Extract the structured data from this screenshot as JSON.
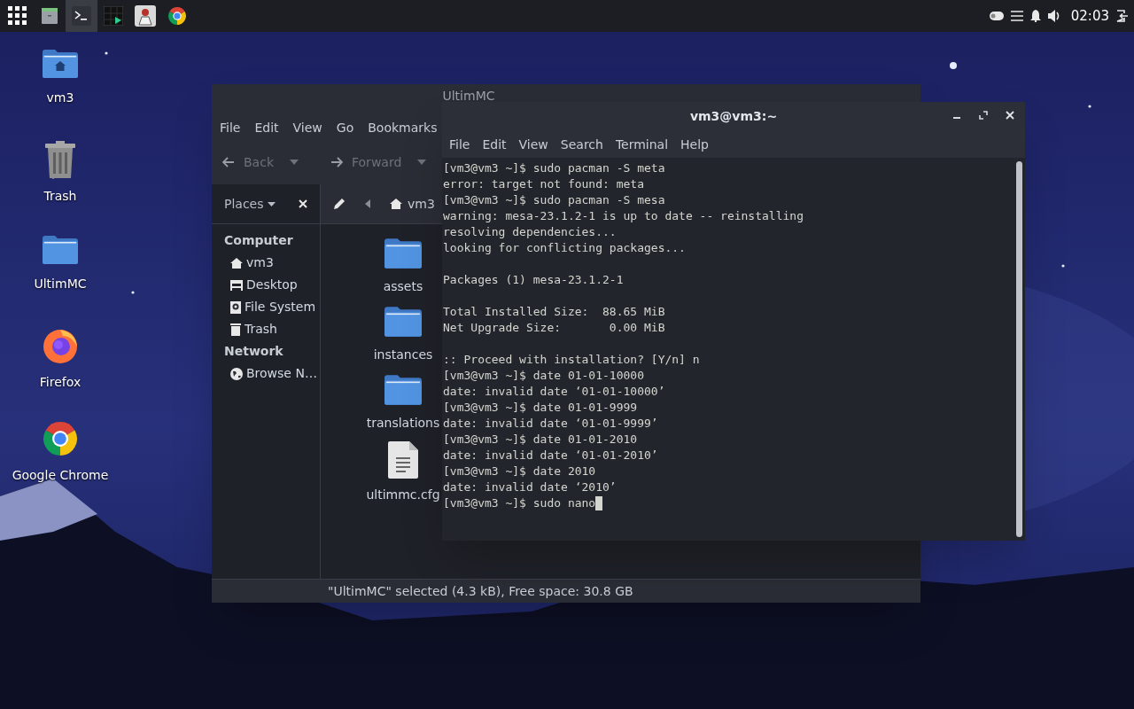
{
  "top_bar": {
    "launchers": [
      {
        "kind": "grid",
        "selected": false
      },
      {
        "kind": "files",
        "selected": false
      },
      {
        "kind": "terminal",
        "selected": true
      },
      {
        "kind": "monitor",
        "selected": false
      },
      {
        "kind": "game",
        "selected": false
      },
      {
        "kind": "browser",
        "selected": false
      }
    ],
    "clock": "02:03"
  },
  "desktop_icons": [
    {
      "label": "vm3",
      "kind": "home"
    },
    {
      "label": "Trash",
      "kind": "trash"
    },
    {
      "label": "UltimMC",
      "kind": "folder"
    },
    {
      "label": "Firefox",
      "kind": "firefox"
    },
    {
      "label": "Google Chrome",
      "kind": "chrome"
    }
  ],
  "file_manager": {
    "title": "UltimMC",
    "menu": [
      "File",
      "Edit",
      "View",
      "Go",
      "Bookmarks"
    ],
    "toolbar": [
      {
        "label": "Back",
        "kind": "back",
        "disabled": true
      },
      {
        "label": "Forward",
        "kind": "forward",
        "disabled": true
      }
    ],
    "places_label": "Places",
    "path": "vm3",
    "sidebar": [
      {
        "heading": "Computer",
        "items": [
          {
            "label": "vm3",
            "kind": "home"
          },
          {
            "label": "Desktop",
            "kind": "desktop"
          },
          {
            "label": "File System",
            "kind": "drive"
          },
          {
            "label": "Trash",
            "kind": "trash"
          }
        ]
      },
      {
        "heading": "Network",
        "items": [
          {
            "label": "Browse N…",
            "kind": "network"
          }
        ]
      }
    ],
    "files": [
      {
        "name": "assets",
        "kind": "folder"
      },
      {
        "name": "instances",
        "kind": "folder"
      },
      {
        "name": "translations",
        "kind": "folder"
      },
      {
        "name": "ultimmc.cfg",
        "kind": "document"
      }
    ],
    "status": "\"UltimMC\" selected (4.3 kB), Free space: 30.8 GB"
  },
  "terminal": {
    "title": "vm3@vm3:~",
    "menu": [
      "File",
      "Edit",
      "View",
      "Search",
      "Terminal",
      "Help"
    ],
    "blocks": [
      [
        "[vm3@vm3 ~]$ sudo pacman -S meta",
        "error: target not found: meta",
        "[vm3@vm3 ~]$ sudo pacman -S mesa",
        "warning: mesa-23.1.2-1 is up to date -- reinstalling",
        "resolving dependencies...",
        "looking for conflicting packages..."
      ],
      [
        "Packages (1) mesa-23.1.2-1"
      ],
      [
        "Total Installed Size:  88.65 MiB",
        "Net Upgrade Size:       0.00 MiB"
      ],
      [
        ":: Proceed with installation? [Y/n] n",
        "[vm3@vm3 ~]$ date 01-01-10000",
        "date: invalid date ‘01-01-10000’",
        "[vm3@vm3 ~]$ date 01-01-9999",
        "date: invalid date ‘01-01-9999’",
        "[vm3@vm3 ~]$ date 01-01-2010",
        "date: invalid date ‘01-01-2010’",
        "[vm3@vm3 ~]$ date 2010",
        "date: invalid date ‘2010’",
        "[vm3@vm3 ~]$ sudo nano"
      ]
    ]
  }
}
